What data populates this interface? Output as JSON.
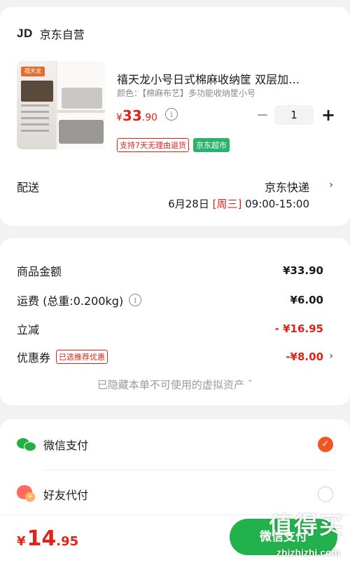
{
  "shop": {
    "logo": "JD",
    "name": "京东自营"
  },
  "product": {
    "title": "禧天龙小号日式棉麻收纳筐 双层加…",
    "spec": "颜色：【棉麻布艺】多功能收纳筐小号",
    "price_symbol": "¥",
    "price_int": "33",
    "price_dec": ".90",
    "quantity": "1",
    "tags": [
      "支持7天无理由退货",
      "京东超市"
    ],
    "thumbnail": {
      "brand": "禧天龙"
    }
  },
  "delivery": {
    "label": "配送",
    "method": "京东快递",
    "date": "6月28日",
    "weekday": "[周三]",
    "window": "09:00-15:00"
  },
  "summary": {
    "goods_label": "商品金额",
    "goods_value": "¥33.90",
    "freight_label": "运费 (总重:0.200kg)",
    "freight_value": "¥6.00",
    "discount_label": "立减",
    "discount_value": "- ¥16.95",
    "coupon_label": "优惠券",
    "coupon_tag": "已选推荐优惠",
    "coupon_value": "-¥8.00",
    "hidden_assets": "已隐藏本单不可使用的虚拟资产 ˇ"
  },
  "payment": {
    "methods": [
      {
        "label": "微信支付",
        "selected": true,
        "icon": "wechat-pay-icon"
      },
      {
        "label": "好友代付",
        "selected": false,
        "icon": "friend-pay-icon"
      }
    ]
  },
  "bottom": {
    "total_symbol": "¥",
    "total_int": "14",
    "total_dec": ".95",
    "pay_button": "微信支付"
  },
  "watermark": {
    "brand": "值得买",
    "url": "zhizhizhi.com"
  },
  "colors": {
    "accent_red": "#e2231a",
    "pay_green": "#22b14c",
    "select_orange": "#f0561f"
  }
}
